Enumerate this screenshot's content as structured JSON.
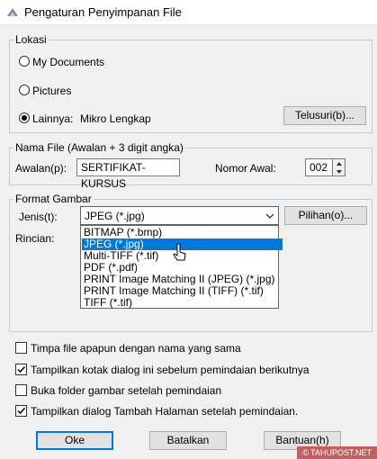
{
  "window": {
    "title": "Pengaturan Penyimpanan File"
  },
  "location": {
    "legend": "Lokasi",
    "options": [
      "My Documents",
      "Pictures",
      "Lainnya:"
    ],
    "selected_index": 2,
    "other_value": "Mikro Lengkap",
    "browse_label": "Telusuri(b)..."
  },
  "filename": {
    "legend": "Nama File (Awalan + 3 digit angka)",
    "prefix_label": "Awalan(p):",
    "prefix_value": "SERTIFIKAT-KURSUS",
    "start_label": "Nomor Awal:",
    "start_value": "002"
  },
  "format": {
    "legend": "Format Gambar",
    "type_label": "Jenis(t):",
    "selected": "JPEG (*.jpg)",
    "options_label": "Pilihan(o)...",
    "details_label": "Rincian:",
    "dropdown_options": [
      "BITMAP (*.bmp)",
      "JPEG (*.jpg)",
      "Multi-TIFF (*.tif)",
      "PDF (*.pdf)",
      "PRINT Image Matching II (JPEG) (*.jpg)",
      "PRINT Image Matching II (TIFF) (*.tif)",
      "TIFF (*.tif)"
    ],
    "highlighted_index": 1
  },
  "checkboxes": [
    {
      "label": "Timpa file apapun dengan nama yang sama",
      "checked": false
    },
    {
      "label": "Tampilkan kotak dialog ini sebelum pemindaian berikutnya",
      "checked": true
    },
    {
      "label": "Buka folder gambar setelah pemindaian",
      "checked": false
    },
    {
      "label": "Tampilkan dialog Tambah Halaman setelah pemindaian.",
      "checked": true
    }
  ],
  "buttons": {
    "ok": "Oke",
    "cancel": "Batalkan",
    "help": "Bantuan(h)"
  },
  "watermark": "© TAHUPOST.NET",
  "colors": {
    "accent": "#0078d7",
    "background": "#f0f0f0"
  }
}
